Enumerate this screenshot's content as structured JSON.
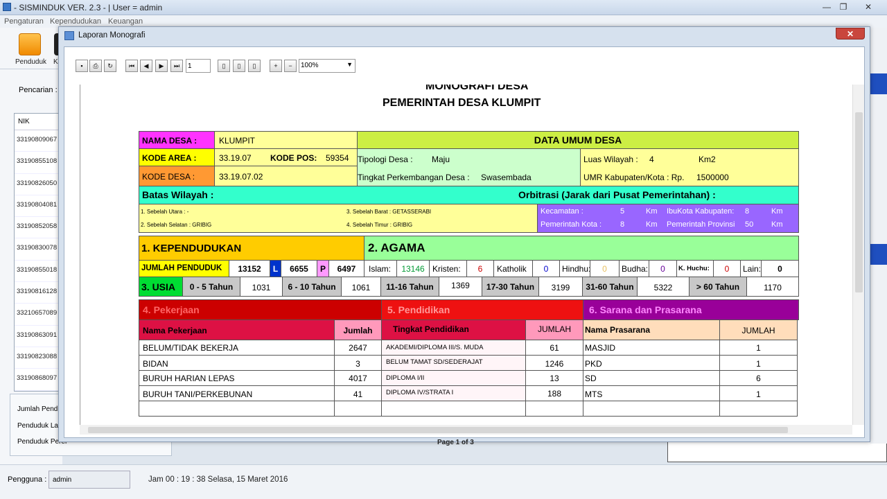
{
  "app": {
    "title": "- SISMINDUK VER. 2.3 - |  User = admin",
    "menu": [
      "Pengaturan",
      "Kependudukan",
      "Keuangan"
    ],
    "toolbar_label": "Penduduk",
    "toolbar_label2": "K",
    "search_label": "Pencarian :",
    "list_header": "NIK",
    "nik_values": [
      "33190809067",
      "33190855108",
      "33190826050",
      "33190804081",
      "33190852058",
      "33190830078",
      "33190855018",
      "33190816128",
      "33210657089",
      "33190863091",
      "33190823088",
      "33190868097"
    ],
    "summary": [
      "Jumlah Pendu",
      "Penduduk Lak",
      "Penduduk Perer"
    ],
    "status_user_label": "Pengguna :",
    "status_user": "admin",
    "status_clock": "Jam 00 : 19 : 38  Selasa, 15  Maret  2016"
  },
  "dialog": {
    "title": "Laporan Monografi",
    "close": "✕",
    "page_value": "1",
    "zoom": "100%",
    "page_indicator": "Page 1 of 3"
  },
  "report": {
    "title1": "MONOGRAFI DESA",
    "title2": "PEMERINTAH DESA KLUMPIT",
    "nama_desa_label": "NAMA DESA :",
    "nama_desa": "KLUMPIT",
    "kode_area_label": "KODE AREA :",
    "kode_area": "33.19.07",
    "kode_pos_label": "KODE POS:",
    "kode_pos": "59354",
    "kode_desa_label": "KODE DESA :",
    "kode_desa": "33.19.07.02",
    "data_umum": "DATA UMUM DESA",
    "tipologi_label": "Tipologi Desa :",
    "tipologi": "Maju",
    "tingkat_label": "Tingkat Perkembangan Desa :",
    "tingkat": "Swasembada",
    "luas_label": "Luas Wilayah :",
    "luas": "4",
    "luas_unit": "Km2",
    "umr_label": "UMR Kabupaten/Kota : Rp.",
    "umr": "1500000",
    "batas": "Batas Wilayah :",
    "orbitrasi": "Orbitrasi (Jarak dari Pusat Pemerintahan) :",
    "utara": "1. Sebelah Utara :      -",
    "selatan": "2. Sebelah Selatan : GRIBIG",
    "barat": "3. Sebelah Barat :  GETASSERABI",
    "timur": "4. Sebelah Timur :  GRIBIG",
    "kecamatan_label": "Kecamatan :",
    "kecamatan": "5",
    "km": "Km",
    "ibukota_label": "IbuKota Kabupaten:",
    "ibukota": "8",
    "pemkota_label": "Pemerintah Kota :",
    "pemkota": "8",
    "provinsi_label": "Pemerintah Provinsi",
    "provinsi": "50",
    "kependudukan": "1. KEPENDUDUKAN",
    "agama": "2. AGAMA",
    "jumlah_label": "JUMLAH PENDUDUK",
    "jumlah": "13152",
    "l": "L",
    "l_val": "6655",
    "p": "P",
    "p_val": "6497",
    "islam_label": "Islam:",
    "islam": "13146",
    "kristen_label": "Kristen:",
    "kristen": "6",
    "katholik_label": "Katholik",
    "katholik": "0",
    "hindhu_label": "Hindhu:",
    "hindhu": "0",
    "budha_label": "Budha:",
    "budha": "0",
    "khuchu_label": "K. Huchu:",
    "khuchu": "0",
    "lain_label": "Lain:",
    "lain": "0",
    "usia": "3. USIA",
    "usia_groups": [
      {
        "label": "0 - 5 Tahun",
        "value": "1031"
      },
      {
        "label": "6 - 10 Tahun",
        "value": "1061"
      },
      {
        "label": "11-16 Tahun",
        "value": "1369"
      },
      {
        "label": "17-30 Tahun",
        "value": "3199"
      },
      {
        "label": "31-60 Tahun",
        "value": "5322"
      },
      {
        "label": "> 60 Tahun",
        "value": "1170"
      }
    ],
    "pekerjaan": "4. Pekerjaan",
    "pendidikan": "5. Pendidikan",
    "sarana": "6. Sarana dan Prasarana",
    "pek_col1": "Nama Pekerjaan",
    "pek_col2": "Jumlah",
    "pend_col1": "Tingkat Pendidikan",
    "pend_col2": "JUMLAH",
    "sar_col1": "Nama Prasarana",
    "sar_col2": "JUMLAH",
    "rows": [
      {
        "pek": "BELUM/TIDAK BEKERJA",
        "pek_n": "2647",
        "pend": "AKADEMI/DIPLOMA III/S. MUDA",
        "pend_n": "61",
        "sar": "MASJID",
        "sar_n": "1"
      },
      {
        "pek": "BIDAN",
        "pek_n": "3",
        "pend": "BELUM TAMAT SD/SEDERAJAT",
        "pend_n": "1246",
        "sar": "PKD",
        "sar_n": "1"
      },
      {
        "pek": "BURUH HARIAN LEPAS",
        "pek_n": "4017",
        "pend": "DIPLOMA I/II",
        "pend_n": "13",
        "sar": "SD",
        "sar_n": "6"
      },
      {
        "pek": "BURUH TANI/PERKEBUNAN",
        "pek_n": "41",
        "pend": "DIPLOMA IV/STRATA I",
        "pend_n": "188",
        "sar": "MTS",
        "sar_n": "1"
      }
    ]
  },
  "colors": {
    "magenta": "#ff33ff",
    "yellow": "#ffff00",
    "orange": "#ff9933",
    "lime": "#ccee44",
    "pale_yellow": "#ffff99",
    "mint": "#ccffcc",
    "cyan": "#33ffcc",
    "purple": "#9966ff",
    "amber": "#ffcc00",
    "light_green": "#99ff99",
    "green": "#00dd33",
    "red": "#cc0000",
    "dark_purple": "#990099"
  }
}
